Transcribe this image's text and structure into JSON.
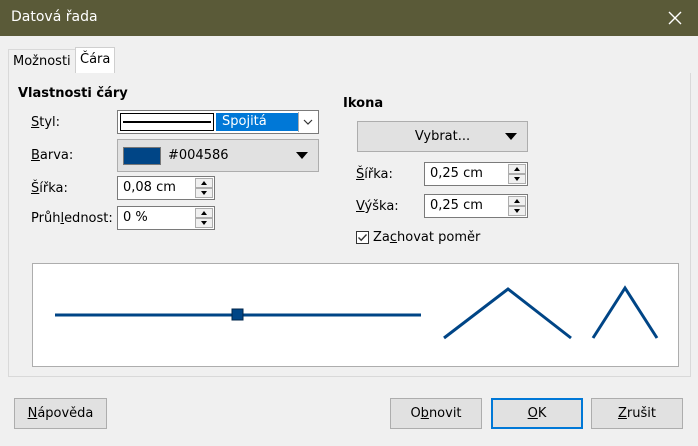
{
  "window": {
    "title": "Datová řada"
  },
  "tabs": [
    {
      "label": "Možnosti",
      "active": false
    },
    {
      "label": "Čára",
      "active": true
    }
  ],
  "line_props": {
    "heading": "Vlastnosti čáry",
    "style_label": "Styl:",
    "style_value": "Spojitá",
    "color_label": "Barva:",
    "color_value": "#004586",
    "color_swatch": "#004586",
    "width_label": "Šířka:",
    "width_value": "0,08 cm",
    "transparency_label": "Průhlednost:",
    "transparency_value": "0 %"
  },
  "icon": {
    "heading": "Ikona",
    "select_label": "Vybrat...",
    "width_label": "Šířka:",
    "width_value": "0,25 cm",
    "height_label": "Výška:",
    "height_value": "0,25 cm",
    "keep_ratio_label": "Zachovat poměr",
    "keep_ratio_checked": true
  },
  "footer": {
    "help_label": "Nápověda",
    "reset_label": "Obnovit",
    "ok_label": "OK",
    "cancel_label": "Zrušit"
  },
  "colors": {
    "accent": "#0078d7",
    "line": "#004586",
    "titlebar": "#5a5a38"
  }
}
